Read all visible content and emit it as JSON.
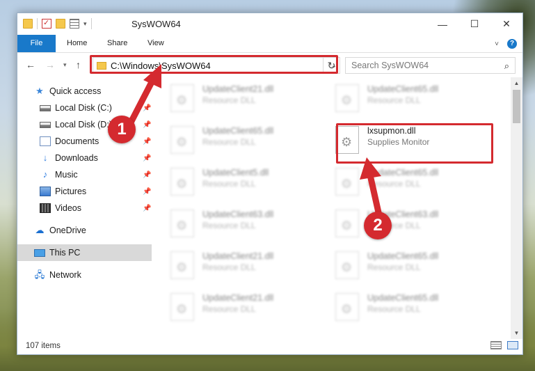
{
  "window": {
    "title": "SysWOW64",
    "controls": {
      "minimize": "—",
      "maximize": "☐",
      "close": "✕"
    }
  },
  "ribbon": {
    "tabs": [
      "File",
      "Home",
      "Share",
      "View"
    ],
    "help_label": "?"
  },
  "address_bar": {
    "path": "C:\\Windows\\SysWOW64",
    "search_placeholder": "Search SysWOW64"
  },
  "nav_pane": {
    "items": [
      {
        "label": "Quick access",
        "icon": "star-icon",
        "pinned": false
      },
      {
        "label": "Local Disk (C:)",
        "icon": "drive-icon",
        "pinned": true
      },
      {
        "label": "Local Disk (D:)",
        "icon": "drive-icon",
        "pinned": true
      },
      {
        "label": "Documents",
        "icon": "documents-icon",
        "pinned": true
      },
      {
        "label": "Downloads",
        "icon": "downloads-icon",
        "pinned": true
      },
      {
        "label": "Music",
        "icon": "music-icon",
        "pinned": true
      },
      {
        "label": "Pictures",
        "icon": "pictures-icon",
        "pinned": true
      },
      {
        "label": "Videos",
        "icon": "videos-icon",
        "pinned": true
      },
      {
        "label": "OneDrive",
        "icon": "onedrive-icon",
        "pinned": false
      },
      {
        "label": "This PC",
        "icon": "pc-icon",
        "pinned": false,
        "selected": true
      },
      {
        "label": "Network",
        "icon": "network-icon",
        "pinned": false
      }
    ]
  },
  "files": [
    {
      "name": "UpdateClient21.dll",
      "desc": "Resource DLL"
    },
    {
      "name": "UpdateClient65.dll",
      "desc": "Resource DLL"
    },
    {
      "name": "UpdateClient65.dll",
      "desc": "Resource DLL"
    },
    {
      "name": "lxsupmon.dll",
      "desc": "Supplies Monitor",
      "highlighted": true
    },
    {
      "name": "UpdateClient5.dll",
      "desc": "Resource DLL"
    },
    {
      "name": "UpdateClient65.dll",
      "desc": "Resource DLL"
    },
    {
      "name": "UpdateClient63.dll",
      "desc": "Resource DLL"
    },
    {
      "name": "UpdateClient63.dll",
      "desc": "Resource DLL"
    },
    {
      "name": "UpdateClient21.dll",
      "desc": "Resource DLL"
    },
    {
      "name": "UpdateClient65.dll",
      "desc": "Resource DLL"
    },
    {
      "name": "UpdateClient21.dll",
      "desc": "Resource DLL"
    },
    {
      "name": "UpdateClient65.dll",
      "desc": "Resource DLL"
    }
  ],
  "status": {
    "item_count": "107 items"
  },
  "annotations": {
    "step1": "1",
    "step2": "2",
    "color": "#d42a2f"
  }
}
